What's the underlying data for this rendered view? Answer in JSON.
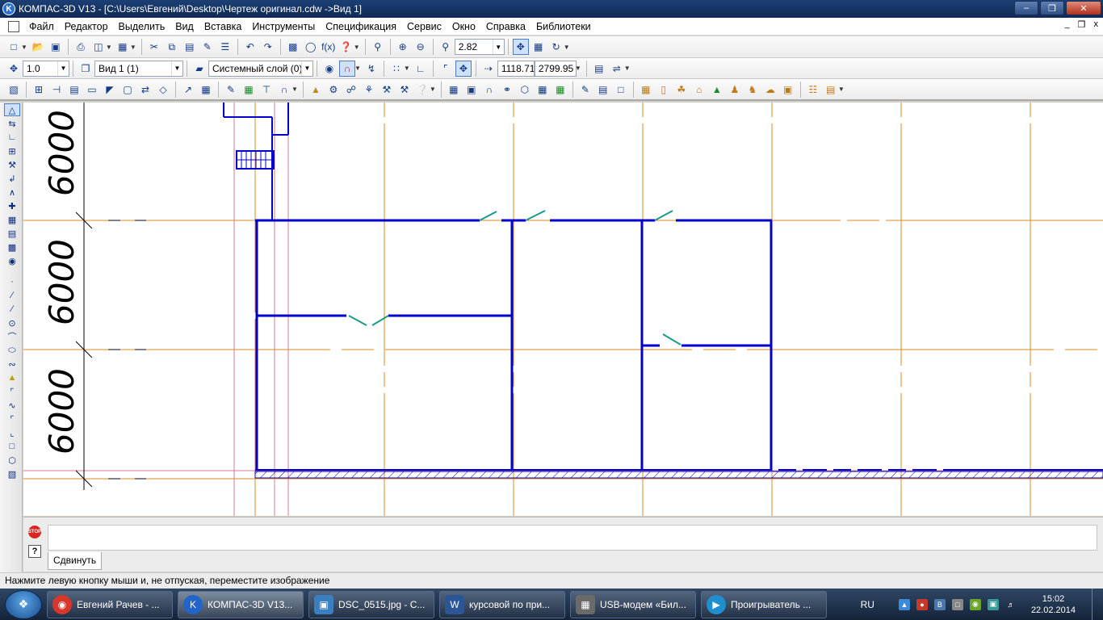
{
  "window": {
    "title": "КОМПАС-3D V13 - [C:\\Users\\Евгений\\Desktop\\Чертеж оригинал.cdw ->Вид 1]",
    "app_icon": "kompas-logo-icon",
    "controls": [
      "minimize-icon",
      "restore-icon",
      "close-icon"
    ]
  },
  "menu": {
    "items": [
      "Файл",
      "Редактор",
      "Выделить",
      "Вид",
      "Вставка",
      "Инструменты",
      "Спецификация",
      "Сервис",
      "Окно",
      "Справка",
      "Библиотеки"
    ],
    "mdi_controls": [
      "_",
      "❐",
      "x"
    ]
  },
  "toolbar_standard": {
    "zoom_value": "2.82"
  },
  "toolbar_current_state": {
    "step": "1.0",
    "view": "Вид 1 (1)",
    "layer": "Системный слой (0)",
    "coord_x": "1118.71",
    "coord_y": "2799.95"
  },
  "drawing": {
    "dimension_labels": [
      "6000",
      "6000",
      "6000"
    ],
    "colors": {
      "walls": "#0000cc",
      "axes": "#e08a1e",
      "doors": "#1a9a8a",
      "format_frame": "#d47a9a",
      "dimension_lines": "#000000"
    }
  },
  "command_panel": {
    "tab_label": "Сдвинуть",
    "stop_label": "STOP"
  },
  "status_bar": {
    "text": "Нажмите левую кнопку мыши и, не отпуская, переместите изображение"
  },
  "taskbar": {
    "items": [
      {
        "label": "Евгений Рачев - ...",
        "icon": "chrome-icon",
        "color": "#d8382b"
      },
      {
        "label": "КОМПАС-3D V13...",
        "icon": "kompas-icon",
        "color": "#2364c8",
        "active": true
      },
      {
        "label": "DSC_0515.jpg - С...",
        "icon": "photo-viewer-icon",
        "color": "#3a7fc0"
      },
      {
        "label": "курсовой по при...",
        "icon": "word-icon",
        "color": "#2b5797"
      },
      {
        "label": "USB-модем «Бил...",
        "icon": "modem-icon",
        "color": "#6a6a6a"
      },
      {
        "label": "Проигрыватель ...",
        "icon": "media-player-icon",
        "color": "#1f8fd0"
      }
    ],
    "tray": {
      "language": "RU",
      "time": "15:02",
      "date": "22.02.2014"
    }
  }
}
